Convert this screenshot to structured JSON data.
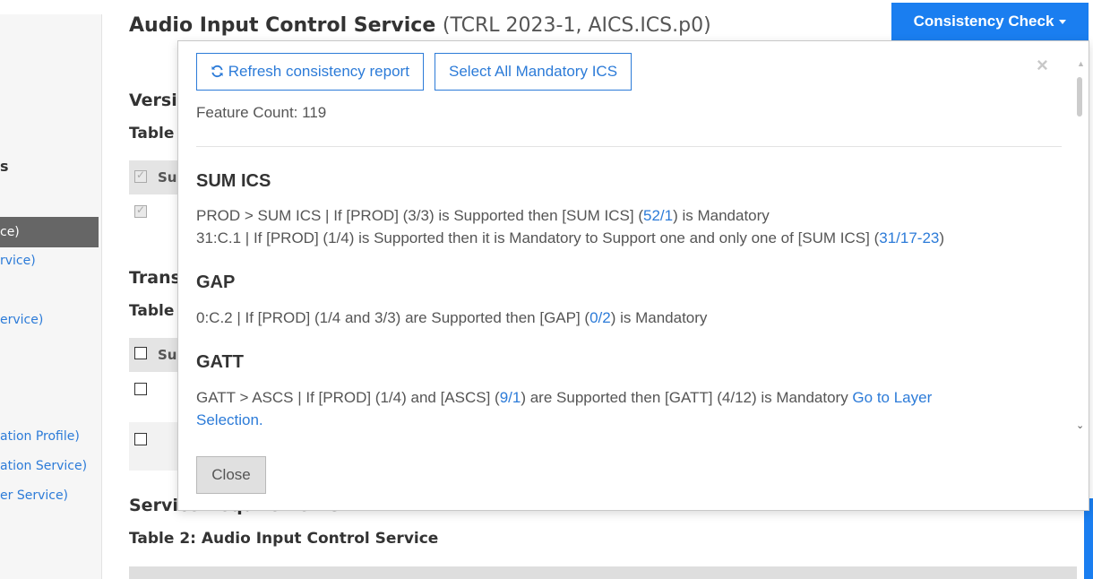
{
  "sidebar": {
    "heading_fragment": "s",
    "active_item": "ce)",
    "items": [
      "rvice)",
      "ervice)",
      "ation Profile)",
      "ation Service)",
      "er Service)"
    ]
  },
  "page": {
    "title": "Audio Input Control Service",
    "subtitle": "(TCRL 2023-1, AICS.ICS.p0)",
    "bg_heading_1": "Versi",
    "bg_table_1": "Table",
    "bg_heading_2": "Trans",
    "bg_table_2": "Table",
    "bg_heading_3": "Service Requirements",
    "bg_table_3": "Table 2: Audio Input Control Service",
    "bg_col_fragment": "Sup"
  },
  "consistency_button": {
    "label": "Consistency Check"
  },
  "modal": {
    "refresh_label": "Refresh consistency report",
    "select_all_label": "Select All Mandatory ICS",
    "close_x": "×",
    "feature_count": "Feature Count: 119",
    "sections": [
      {
        "heading": "SUM ICS",
        "lines": [
          {
            "pre": "PROD > SUM ICS | If [PROD] (3/3) is Supported then [SUM ICS] (",
            "link": "52/1",
            "post": ") is Mandatory"
          },
          {
            "pre": "31:C.1 | If [PROD] (1/4) is Supported then it is Mandatory to Support one and only one of [SUM ICS] (",
            "link": "31/17-23",
            "post": ")"
          }
        ]
      },
      {
        "heading": "GAP",
        "lines": [
          {
            "pre": "0:C.2 | If [PROD] (1/4 and 3/3) are Supported then [GAP] (",
            "link": "0/2",
            "post": ") is Mandatory"
          }
        ]
      },
      {
        "heading": "GATT",
        "lines": [
          {
            "pre": "GATT > ASCS | If [PROD] (1/4) and [ASCS] (",
            "link": "9/1",
            "post": ") are Supported then [GATT] (4/12) is Mandatory ",
            "link2": "Go to Layer"
          },
          {
            "link": "Selection."
          }
        ]
      }
    ],
    "close_label": "Close"
  }
}
